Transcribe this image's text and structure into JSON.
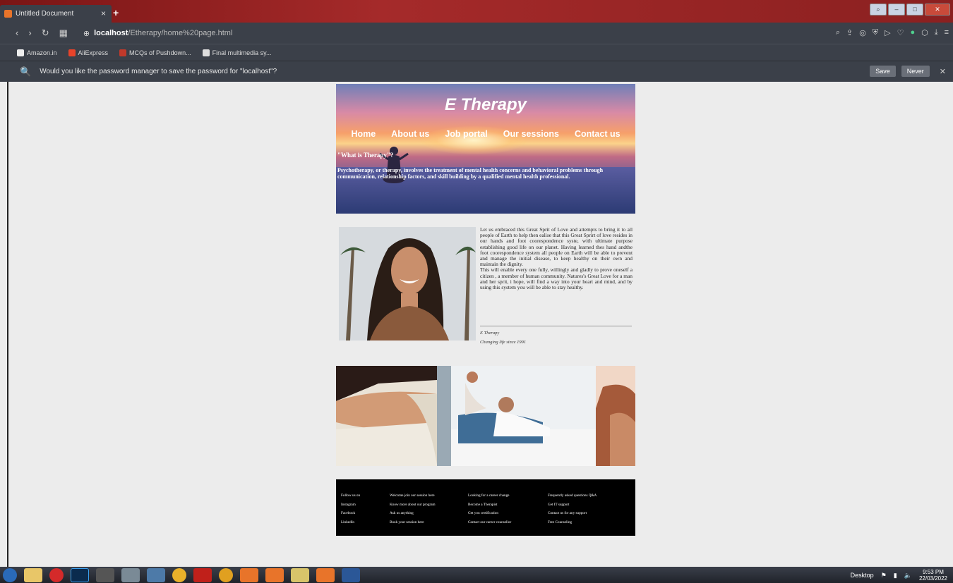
{
  "browser": {
    "tab_title": "Untitled Document",
    "new_tab": "+",
    "close_tab": "×",
    "url_host": "localhost",
    "url_path": "/Etherapy/home%20page.html",
    "bookmarks": [
      {
        "label": "Amazon.in",
        "color": "#222"
      },
      {
        "label": "AliExpress",
        "color": "#e8432a"
      },
      {
        "label": "MCQs of Pushdown...",
        "color": "#c0392b"
      },
      {
        "label": "Final multimedia sy...",
        "color": "#ddd"
      }
    ],
    "password_prompt": "Would you like the password manager to save the password for \"localhost\"?",
    "save_label": "Save",
    "never_label": "Never"
  },
  "hero": {
    "title": "E Therapy",
    "menu": [
      "Home",
      "About us",
      "Job portal",
      "Our sessions",
      "Contact us"
    ],
    "question": "\"What is Therapy\"?",
    "description": "Psychotherapy, or therapy, involves the treatment of mental health concerns and behavioral problems through communication, relationship factors, and skill building by a qualified mental health professional."
  },
  "about": {
    "paragraph1": "Let us embraced this Great Sprit of Love and attempts to bring it to all people of Earth to help then ealise that this Great Sprirt of love resides in our hands and foot coorespondence syste, with ultimate purpose establishing good life on our planet. Having learned thes hand andthe foot coorespondence system all people on Earth will be able to prevent and manage the initial disease, to keep healthy on their own and maintain the dignity.",
    "paragraph2": "This will enable every one fully, willingly and gladly to prove oneself a citizen , a member of human community. Natures's Great Love for a man and her sprit, i hope, will find a way into your heart and mind, and by using this system you will be able to stay healthy.",
    "sig1": "E Therapy",
    "sig2": "Changing life since 1991"
  },
  "footer": {
    "col1": [
      "Follow us on",
      "Instagram",
      "Facebook",
      "LinkedIn"
    ],
    "col2": [
      "Welcome join our session here",
      "Know more about our program",
      "Ask us anything",
      "Book your session here"
    ],
    "col3": [
      "Looking for a career change",
      "Become a Therapist",
      "Get you certification",
      "Contact our career counsellor"
    ],
    "col4": [
      "Frequently asked questions Q&A",
      "Get IT support",
      "Contact us for any support",
      "Free Counseling"
    ]
  },
  "taskbar": {
    "desktop": "Desktop",
    "time": "9:53 PM",
    "date": "22/03/2022"
  },
  "colors": {
    "accent": "#3b4049",
    "titlebar": "#a52a2a"
  }
}
